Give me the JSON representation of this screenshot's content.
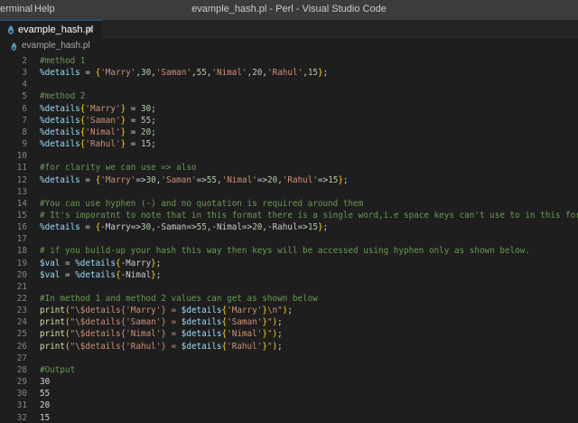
{
  "menu": {
    "terminal": "erminal",
    "help": "Help"
  },
  "window": {
    "title": "evample_hash.pl - Perl - Visual Studio Code"
  },
  "tab": {
    "label": "evample_hash.pl",
    "close": "×"
  },
  "breadcrumb": {
    "file": "evample_hash.pl"
  },
  "colors": {
    "accent": "#0e639c",
    "background": "#1e1e1e",
    "comment": "#6a9955"
  },
  "editor": {
    "lines": [
      {
        "n": "2",
        "tokens": [
          {
            "t": "#method 1",
            "c": "comment"
          }
        ]
      },
      {
        "n": "3",
        "tokens": [
          {
            "t": "%details",
            "c": "var"
          },
          {
            "t": " = ",
            "c": "punct"
          },
          {
            "t": "{",
            "c": "brace"
          },
          {
            "t": "'Marry'",
            "c": "string"
          },
          {
            "t": ",",
            "c": "punct"
          },
          {
            "t": "30",
            "c": "num"
          },
          {
            "t": ",",
            "c": "punct"
          },
          {
            "t": "'Saman'",
            "c": "string"
          },
          {
            "t": ",",
            "c": "punct"
          },
          {
            "t": "55",
            "c": "num"
          },
          {
            "t": ",",
            "c": "punct"
          },
          {
            "t": "'Nimal'",
            "c": "string"
          },
          {
            "t": ",",
            "c": "punct"
          },
          {
            "t": "20",
            "c": "num"
          },
          {
            "t": ",",
            "c": "punct"
          },
          {
            "t": "'Rahul'",
            "c": "string"
          },
          {
            "t": ",",
            "c": "punct"
          },
          {
            "t": "15",
            "c": "num"
          },
          {
            "t": "}",
            "c": "brace"
          },
          {
            "t": ";",
            "c": "punct"
          }
        ]
      },
      {
        "n": "4",
        "tokens": []
      },
      {
        "n": "5",
        "tokens": [
          {
            "t": "#method 2",
            "c": "comment"
          }
        ]
      },
      {
        "n": "6",
        "tokens": [
          {
            "t": "%details",
            "c": "var"
          },
          {
            "t": "{",
            "c": "brace"
          },
          {
            "t": "'Marry'",
            "c": "string"
          },
          {
            "t": "}",
            "c": "brace"
          },
          {
            "t": " = ",
            "c": "punct"
          },
          {
            "t": "30",
            "c": "num"
          },
          {
            "t": ";",
            "c": "punct"
          }
        ]
      },
      {
        "n": "7",
        "tokens": [
          {
            "t": "%details",
            "c": "var"
          },
          {
            "t": "{",
            "c": "brace"
          },
          {
            "t": "'Saman'",
            "c": "string"
          },
          {
            "t": "}",
            "c": "brace"
          },
          {
            "t": " = ",
            "c": "punct"
          },
          {
            "t": "55",
            "c": "num"
          },
          {
            "t": ";",
            "c": "punct"
          }
        ]
      },
      {
        "n": "8",
        "tokens": [
          {
            "t": "%details",
            "c": "var"
          },
          {
            "t": "{",
            "c": "brace"
          },
          {
            "t": "'Nimal'",
            "c": "string"
          },
          {
            "t": "}",
            "c": "brace"
          },
          {
            "t": " = ",
            "c": "punct"
          },
          {
            "t": "20",
            "c": "num"
          },
          {
            "t": ";",
            "c": "punct"
          }
        ]
      },
      {
        "n": "9",
        "tokens": [
          {
            "t": "%details",
            "c": "var"
          },
          {
            "t": "{",
            "c": "brace"
          },
          {
            "t": "'Rahul'",
            "c": "string"
          },
          {
            "t": "}",
            "c": "brace"
          },
          {
            "t": " = ",
            "c": "punct"
          },
          {
            "t": "15",
            "c": "num"
          },
          {
            "t": ";",
            "c": "punct"
          }
        ]
      },
      {
        "n": "10",
        "tokens": []
      },
      {
        "n": "11",
        "tokens": [
          {
            "t": "#for clarity we can use => also",
            "c": "comment"
          }
        ]
      },
      {
        "n": "12",
        "tokens": [
          {
            "t": "%details",
            "c": "var"
          },
          {
            "t": " = ",
            "c": "punct"
          },
          {
            "t": "{",
            "c": "brace"
          },
          {
            "t": "'Marry'",
            "c": "string"
          },
          {
            "t": "=>",
            "c": "punct"
          },
          {
            "t": "30",
            "c": "num"
          },
          {
            "t": ",",
            "c": "punct"
          },
          {
            "t": "'Saman'",
            "c": "string"
          },
          {
            "t": "=>",
            "c": "punct"
          },
          {
            "t": "55",
            "c": "num"
          },
          {
            "t": ",",
            "c": "punct"
          },
          {
            "t": "'Nimal'",
            "c": "string"
          },
          {
            "t": "=>",
            "c": "punct"
          },
          {
            "t": "20",
            "c": "num"
          },
          {
            "t": ",",
            "c": "punct"
          },
          {
            "t": "'Rahul'",
            "c": "string"
          },
          {
            "t": "=>",
            "c": "punct"
          },
          {
            "t": "15",
            "c": "num"
          },
          {
            "t": "}",
            "c": "brace"
          },
          {
            "t": ";",
            "c": "punct"
          }
        ]
      },
      {
        "n": "13",
        "tokens": []
      },
      {
        "n": "14",
        "tokens": [
          {
            "t": "#You can use hyphen (-) and no quotation is required around them",
            "c": "comment"
          }
        ]
      },
      {
        "n": "15",
        "tokens": [
          {
            "t": "# It's imporatnt to note that in this format there is a single word,i.e space keys can't use to in this format",
            "c": "comment"
          }
        ]
      },
      {
        "n": "16",
        "tokens": [
          {
            "t": "%details",
            "c": "var"
          },
          {
            "t": " = ",
            "c": "punct"
          },
          {
            "t": "{",
            "c": "brace"
          },
          {
            "t": "-Marry",
            "c": "key"
          },
          {
            "t": "=>",
            "c": "punct"
          },
          {
            "t": "30",
            "c": "num"
          },
          {
            "t": ",",
            "c": "punct"
          },
          {
            "t": "-Saman",
            "c": "key"
          },
          {
            "t": "=>",
            "c": "punct"
          },
          {
            "t": "55",
            "c": "num"
          },
          {
            "t": ",",
            "c": "punct"
          },
          {
            "t": "-Nimal",
            "c": "key"
          },
          {
            "t": "=>",
            "c": "punct"
          },
          {
            "t": "20",
            "c": "num"
          },
          {
            "t": ",",
            "c": "punct"
          },
          {
            "t": "-Rahul",
            "c": "key"
          },
          {
            "t": "=>",
            "c": "punct"
          },
          {
            "t": "15",
            "c": "num"
          },
          {
            "t": "}",
            "c": "brace"
          },
          {
            "t": ";",
            "c": "punct"
          }
        ]
      },
      {
        "n": "17",
        "tokens": []
      },
      {
        "n": "18",
        "tokens": [
          {
            "t": "# if you build-up your hash this way then keys will be accessed using hyphen only as shown below.",
            "c": "comment"
          }
        ]
      },
      {
        "n": "19",
        "tokens": [
          {
            "t": "$val",
            "c": "var"
          },
          {
            "t": " = ",
            "c": "punct"
          },
          {
            "t": "%details",
            "c": "var"
          },
          {
            "t": "{",
            "c": "brace"
          },
          {
            "t": "-Marry",
            "c": "key"
          },
          {
            "t": "}",
            "c": "brace"
          },
          {
            "t": ";",
            "c": "punct"
          }
        ]
      },
      {
        "n": "20",
        "tokens": [
          {
            "t": "$val",
            "c": "var"
          },
          {
            "t": " = ",
            "c": "punct"
          },
          {
            "t": "%details",
            "c": "var"
          },
          {
            "t": "{",
            "c": "brace"
          },
          {
            "t": "-Nimal",
            "c": "key"
          },
          {
            "t": "}",
            "c": "brace"
          },
          {
            "t": ";",
            "c": "punct"
          }
        ]
      },
      {
        "n": "21",
        "tokens": []
      },
      {
        "n": "22",
        "tokens": [
          {
            "t": "#In method 1 and method 2 values can get as shown below",
            "c": "comment"
          }
        ]
      },
      {
        "n": "23",
        "tokens": [
          {
            "t": "print",
            "c": "func"
          },
          {
            "t": "(",
            "c": "brace"
          },
          {
            "t": "\"\\$details{'Marry'} = ",
            "c": "string"
          },
          {
            "t": "$details",
            "c": "var"
          },
          {
            "t": "{",
            "c": "brace"
          },
          {
            "t": "'Marry'",
            "c": "string"
          },
          {
            "t": "}",
            "c": "brace"
          },
          {
            "t": "\\n\"",
            "c": "string"
          },
          {
            "t": ")",
            "c": "brace"
          },
          {
            "t": ";",
            "c": "punct"
          }
        ]
      },
      {
        "n": "24",
        "tokens": [
          {
            "t": "print",
            "c": "func"
          },
          {
            "t": "(",
            "c": "brace"
          },
          {
            "t": "\"\\$details{'Saman'} = ",
            "c": "string"
          },
          {
            "t": "$details",
            "c": "var"
          },
          {
            "t": "{",
            "c": "brace"
          },
          {
            "t": "'Saman'",
            "c": "string"
          },
          {
            "t": "}",
            "c": "brace"
          },
          {
            "t": "\"",
            "c": "string"
          },
          {
            "t": ")",
            "c": "brace"
          },
          {
            "t": ";",
            "c": "punct"
          }
        ]
      },
      {
        "n": "25",
        "tokens": [
          {
            "t": "print",
            "c": "func"
          },
          {
            "t": "(",
            "c": "brace"
          },
          {
            "t": "\"\\$details{'Nimal'} = ",
            "c": "string"
          },
          {
            "t": "$details",
            "c": "var"
          },
          {
            "t": "{",
            "c": "brace"
          },
          {
            "t": "'Nimal'",
            "c": "string"
          },
          {
            "t": "}",
            "c": "brace"
          },
          {
            "t": "\"",
            "c": "string"
          },
          {
            "t": ")",
            "c": "brace"
          },
          {
            "t": ";",
            "c": "punct"
          }
        ]
      },
      {
        "n": "26",
        "tokens": [
          {
            "t": "print",
            "c": "func"
          },
          {
            "t": "(",
            "c": "brace"
          },
          {
            "t": "\"\\$details{'Rahul'} = ",
            "c": "string"
          },
          {
            "t": "$details",
            "c": "var"
          },
          {
            "t": "{",
            "c": "brace"
          },
          {
            "t": "'Rahul'",
            "c": "string"
          },
          {
            "t": "}",
            "c": "brace"
          },
          {
            "t": "\"",
            "c": "string"
          },
          {
            "t": ")",
            "c": "brace"
          },
          {
            "t": ";",
            "c": "punct"
          }
        ]
      },
      {
        "n": "27",
        "tokens": []
      },
      {
        "n": "28",
        "tokens": [
          {
            "t": "#Output",
            "c": "comment"
          }
        ]
      },
      {
        "n": "29",
        "tokens": [
          {
            "t": "30",
            "c": "text"
          }
        ]
      },
      {
        "n": "30",
        "tokens": [
          {
            "t": "55",
            "c": "text"
          }
        ]
      },
      {
        "n": "31",
        "tokens": [
          {
            "t": "20",
            "c": "text"
          }
        ]
      },
      {
        "n": "32",
        "tokens": [
          {
            "t": "15",
            "c": "text"
          }
        ]
      }
    ]
  }
}
